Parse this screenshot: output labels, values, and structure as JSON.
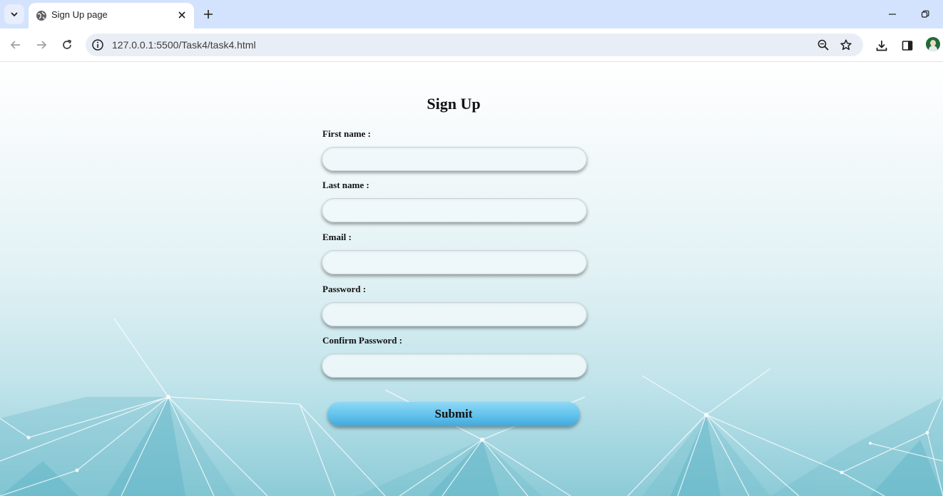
{
  "browser": {
    "tab": {
      "title": "Sign Up page",
      "favicon": "globe-icon"
    },
    "url": "127.0.0.1:5500/Task4/task4.html",
    "accent_color": "#d3e3fd"
  },
  "form": {
    "title": "Sign Up",
    "fields": [
      {
        "label": "First name :",
        "value": ""
      },
      {
        "label": "Last name :",
        "value": ""
      },
      {
        "label": "Email :",
        "value": ""
      },
      {
        "label": "Password :",
        "value": ""
      },
      {
        "label": "Confirm Password :",
        "value": ""
      }
    ],
    "submit_label": "Submit",
    "button_color": "#62c2ec"
  }
}
